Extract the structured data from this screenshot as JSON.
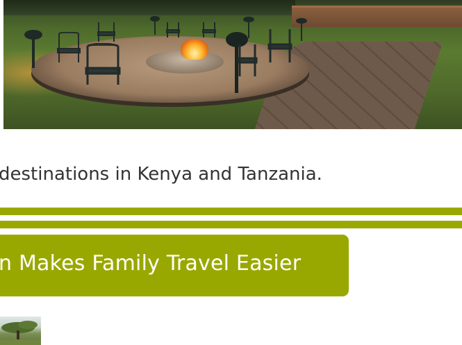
{
  "hero": {
    "alt": "Campfire circle with chairs and lanterns at a safari lodge at dusk"
  },
  "intro": {
    "text": "destinations in Kenya and Tanzania."
  },
  "banner": {
    "title": "n Makes Family Travel Easier"
  },
  "thumbnail": {
    "alt": "Acacia tree thumbnail"
  },
  "colors": {
    "accent": "#99a800",
    "text": "#333333",
    "banner_text": "#ffffff"
  }
}
